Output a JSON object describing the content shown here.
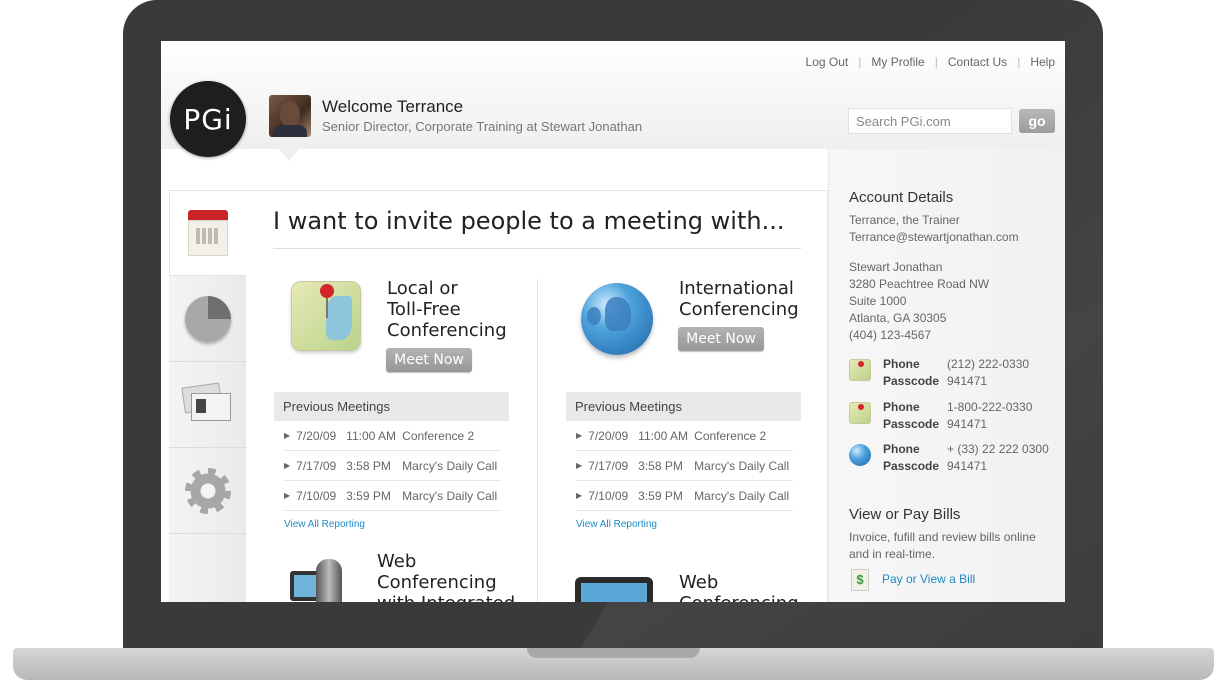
{
  "header": {
    "links": [
      "Log Out",
      "My Profile",
      "Contact Us",
      "Help"
    ],
    "logo_text": "PGi",
    "welcome": "Welcome Terrance",
    "subtitle": "Senior Director, Corporate Training at Stewart Jonathan",
    "search_placeholder": "Search PGi.com",
    "go_label": "go"
  },
  "rail": {
    "items": [
      "calendar-icon",
      "pie-chart-icon",
      "contact-cards-icon",
      "gear-icon"
    ]
  },
  "main": {
    "title": "I want to invite people to a meeting with...",
    "local": {
      "title_lines": [
        "Local or",
        "Toll-Free",
        "Conferencing"
      ],
      "button": "Meet Now",
      "prev_header": "Previous Meetings",
      "meetings": [
        {
          "date": "7/20/09",
          "time": "11:00 AM",
          "name": "Conference 2"
        },
        {
          "date": "7/17/09",
          "time": "3:58 PM",
          "name": "Marcy's Daily Call"
        },
        {
          "date": "7/10/09",
          "time": "3:59 PM",
          "name": "Marcy's Daily Call"
        }
      ],
      "view_all": "View All Reporting"
    },
    "international": {
      "title_lines": [
        "International",
        "Conferencing"
      ],
      "button": "Meet Now",
      "prev_header": "Previous Meetings",
      "meetings": [
        {
          "date": "7/20/09",
          "time": "11:00 AM",
          "name": "Conference 2"
        },
        {
          "date": "7/17/09",
          "time": "3:58 PM",
          "name": "Marcy's Daily Call"
        },
        {
          "date": "7/10/09",
          "time": "3:59 PM",
          "name": "Marcy's Daily Call"
        }
      ],
      "view_all": "View All Reporting"
    },
    "web_integrated": {
      "title_lines": [
        "Web",
        "Conferencing",
        "with Integrated"
      ]
    },
    "web": {
      "title_lines": [
        "Web",
        "Conferencing"
      ]
    }
  },
  "sidebar": {
    "account_title": "Account Details",
    "account_name": "Terrance, the Trainer",
    "account_email": "Terrance@stewartjonathan.com",
    "address": [
      "Stewart Jonathan",
      "3280 Peachtree Road NW",
      "Suite 1000",
      "Atlanta, GA  30305",
      "(404) 123-4567"
    ],
    "phones": [
      {
        "phone_label": "Phone",
        "phone": "(212) 222-0330",
        "pass_label": "Passcode",
        "passcode": "941471",
        "icon": "map-icon"
      },
      {
        "phone_label": "Phone",
        "phone": "1-800-222-0330",
        "pass_label": "Passcode",
        "passcode": "941471",
        "icon": "map-icon"
      },
      {
        "phone_label": "Phone",
        "phone": "+ (33) 22 222 0300",
        "pass_label": "Passcode",
        "passcode": "941471",
        "icon": "globe-icon"
      }
    ],
    "bills_title": "View or Pay Bills",
    "bills_text": "Invoice, fufill and review bills online and in real-time.",
    "bills_link": "Pay or View a Bill",
    "bills_icon_glyph": "$"
  }
}
